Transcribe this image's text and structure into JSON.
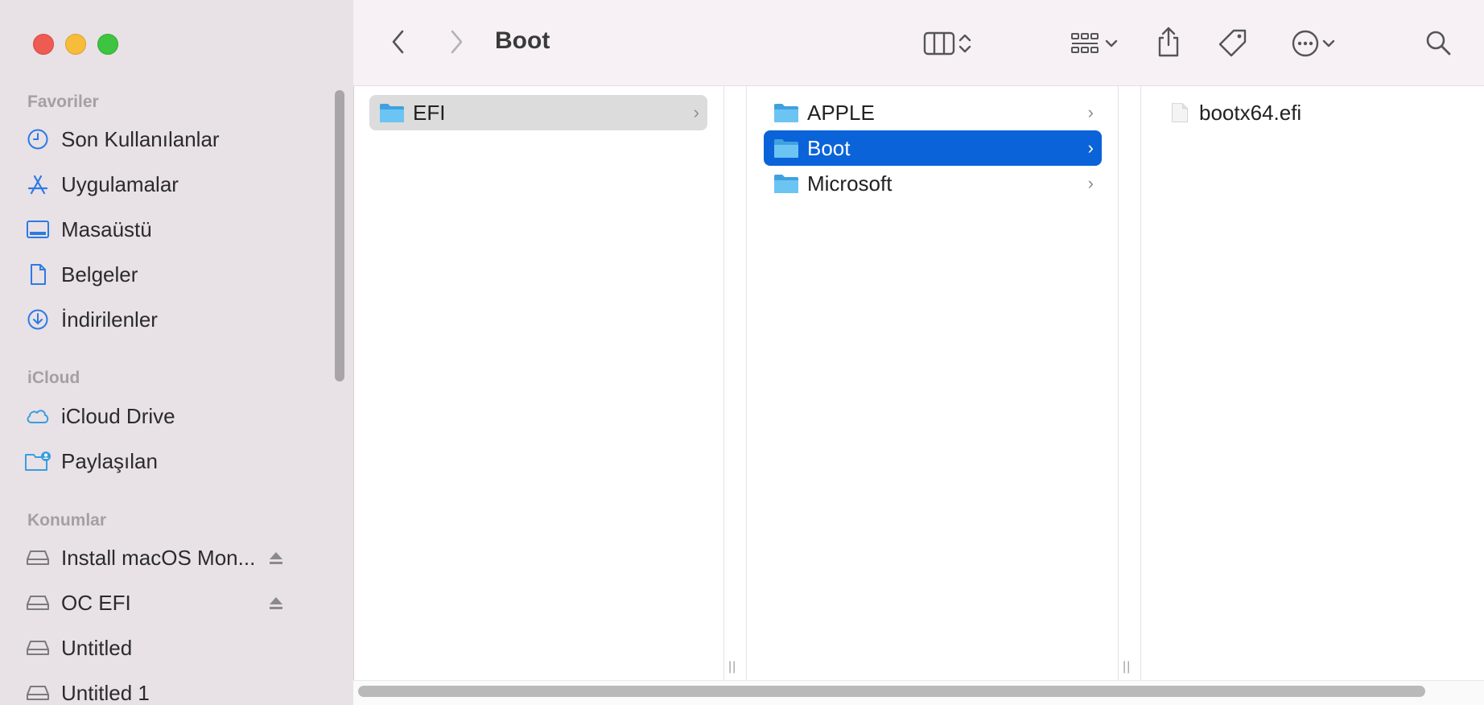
{
  "window": {
    "title": "Boot"
  },
  "sidebar": {
    "sections": [
      {
        "header": "Favoriler",
        "items": [
          {
            "label": "Son Kullanılanlar",
            "icon": "clock-icon"
          },
          {
            "label": "Uygulamalar",
            "icon": "applications-icon"
          },
          {
            "label": "Masaüstü",
            "icon": "desktop-icon"
          },
          {
            "label": "Belgeler",
            "icon": "document-icon"
          },
          {
            "label": "İndirilenler",
            "icon": "download-icon"
          }
        ]
      },
      {
        "header": "iCloud",
        "items": [
          {
            "label": "iCloud Drive",
            "icon": "cloud-icon"
          },
          {
            "label": "Paylaşılan",
            "icon": "shared-folder-icon"
          }
        ]
      },
      {
        "header": "Konumlar",
        "items": [
          {
            "label": "Install macOS Mon...",
            "icon": "disk-icon",
            "eject": true
          },
          {
            "label": "OC EFI",
            "icon": "disk-icon",
            "eject": true
          },
          {
            "label": "Untitled",
            "icon": "disk-icon"
          },
          {
            "label": "Untitled 1",
            "icon": "disk-icon"
          }
        ]
      }
    ]
  },
  "columns": [
    {
      "items": [
        {
          "label": "EFI",
          "type": "folder",
          "selected": "gray"
        }
      ]
    },
    {
      "items": [
        {
          "label": "APPLE",
          "type": "folder"
        },
        {
          "label": "Boot",
          "type": "folder",
          "selected": "blue"
        },
        {
          "label": "Microsoft",
          "type": "folder"
        }
      ]
    },
    {
      "items": [
        {
          "label": "bootx64.efi",
          "type": "file"
        }
      ]
    }
  ],
  "colors": {
    "accent": "#0a63d9",
    "icon_blue": "#2c7be5",
    "folder": "#5ab4ec"
  }
}
